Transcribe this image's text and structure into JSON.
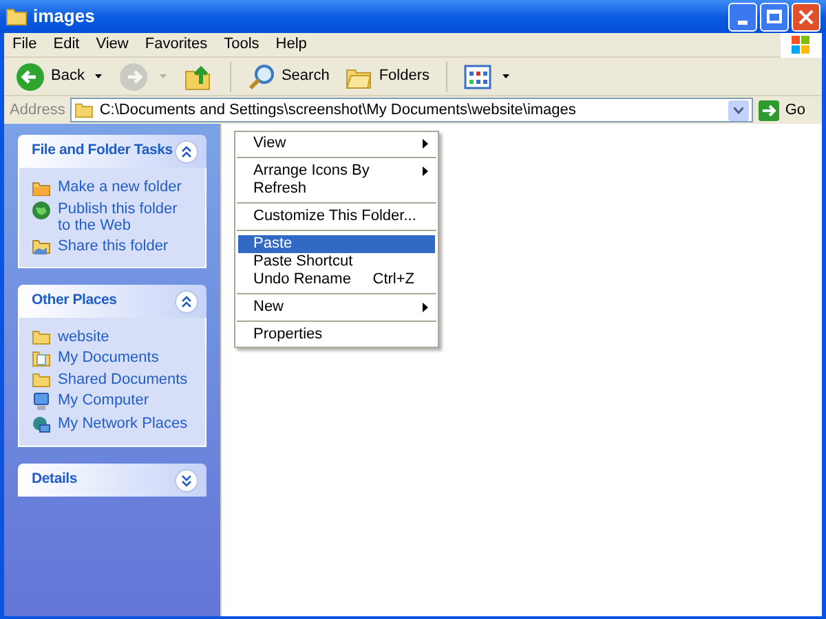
{
  "window": {
    "title": "images"
  },
  "menu_bar": [
    "File",
    "Edit",
    "View",
    "Favorites",
    "Tools",
    "Help"
  ],
  "toolbar": [
    {
      "kind": "back",
      "label": "Back",
      "disabled": false
    },
    {
      "kind": "forward",
      "disabled": true
    },
    {
      "kind": "up",
      "disabled": false
    },
    {
      "kind": "search",
      "label": "Search",
      "disabled": false
    },
    {
      "kind": "folders",
      "label": "Folders",
      "disabled": false
    },
    {
      "kind": "views",
      "disabled": false
    }
  ],
  "address_bar": {
    "label": "Address",
    "value": "C:\\Documents and Settings\\screenshot\\My Documents\\website\\images",
    "go": "Go"
  },
  "task_panels": [
    {
      "title": "File and Folder Tasks",
      "expanded": true,
      "items": [
        {
          "kind": "new-folder",
          "label": "Make a new folder"
        },
        {
          "kind": "globe",
          "label": "Publish this folder to the Web"
        },
        {
          "kind": "share",
          "label": "Share this folder"
        }
      ]
    },
    {
      "title": "Other Places",
      "expanded": true,
      "items": [
        {
          "kind": "folder",
          "label": "website"
        },
        {
          "kind": "documents",
          "label": "My Documents"
        },
        {
          "kind": "folder",
          "label": "Shared Documents"
        },
        {
          "kind": "computer",
          "label": "My Computer"
        },
        {
          "kind": "network",
          "label": "My Network Places"
        }
      ]
    },
    {
      "title": "Details",
      "expanded": false
    }
  ],
  "context_menu": {
    "groups": [
      [
        {
          "label": "View",
          "submenu": true,
          "selected": false
        }
      ],
      [
        {
          "label": "Arrange Icons By",
          "submenu": true,
          "selected": false
        },
        {
          "label": "Refresh",
          "submenu": false,
          "selected": false
        }
      ],
      [
        {
          "label": "Customize This Folder...",
          "submenu": false,
          "selected": false
        }
      ],
      [
        {
          "label": "Paste",
          "submenu": false,
          "selected": true
        },
        {
          "label": "Paste Shortcut",
          "submenu": false,
          "selected": false
        },
        {
          "label": "Undo Rename",
          "shortcut": "Ctrl+Z",
          "submenu": false,
          "selected": false
        }
      ],
      [
        {
          "label": "New",
          "submenu": true,
          "selected": false
        }
      ],
      [
        {
          "label": "Properties",
          "submenu": false,
          "selected": false
        }
      ]
    ]
  }
}
